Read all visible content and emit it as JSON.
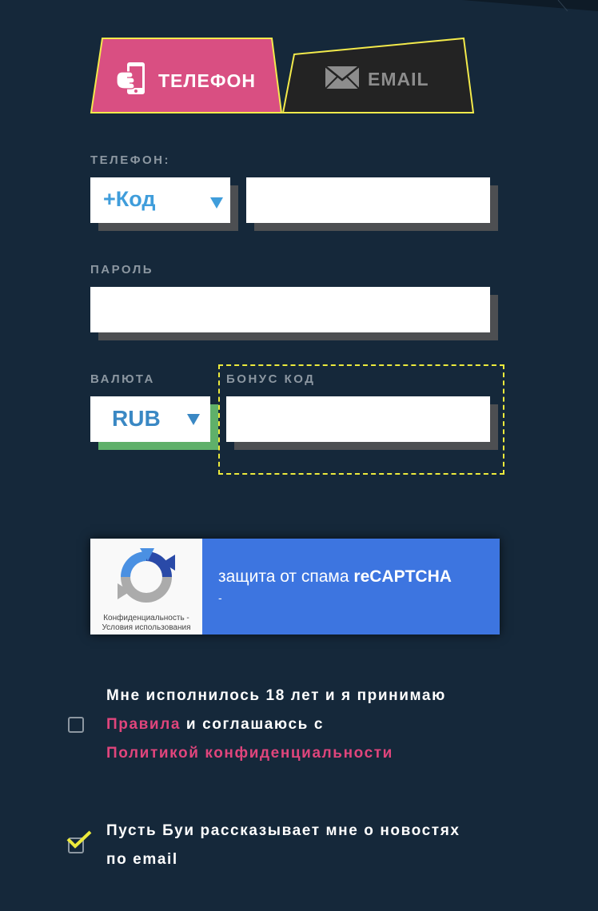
{
  "tabs": {
    "phone_label": "ТЕЛЕФОН",
    "email_label": "EMAIL",
    "active": "phone"
  },
  "phone": {
    "label": "ТЕЛЕФОН:",
    "code_placeholder": "+Код",
    "number_value": ""
  },
  "password": {
    "label": "ПАРОЛЬ",
    "value": ""
  },
  "currency": {
    "label": "ВАЛЮТА",
    "selected": "RUB"
  },
  "bonus": {
    "label": "БОНУС КОД",
    "value": ""
  },
  "captcha": {
    "title_prefix": "защита от спама ",
    "title_brand": "reCAPTCHA",
    "dash": "-",
    "privacy": "Конфиденциальность -",
    "terms": "Условия использования"
  },
  "consent": {
    "line1": "Мне исполнилось 18 лет и я принимаю",
    "rules_link": "Правила",
    "middle": " и соглашаюсь с",
    "policy_link": "Политикой конфиденциальности",
    "checked": false
  },
  "newsletter": {
    "line1": "Пусть Буи рассказывает мне о новостях",
    "line2": "по email",
    "checked": true
  },
  "colors": {
    "background": "#15283a",
    "active_tab": "#d94f82",
    "tab_border": "#f3ea4b",
    "accent_blue": "#3f9ddb",
    "link_pink": "#e0457c",
    "captcha_blue": "#3d75e0",
    "currency_green": "#5fb06a"
  },
  "icons": [
    "phone-hand-icon",
    "envelope-icon",
    "eye-icon",
    "chevron-down-icon",
    "recaptcha-logo-icon",
    "checkmark-icon"
  ]
}
